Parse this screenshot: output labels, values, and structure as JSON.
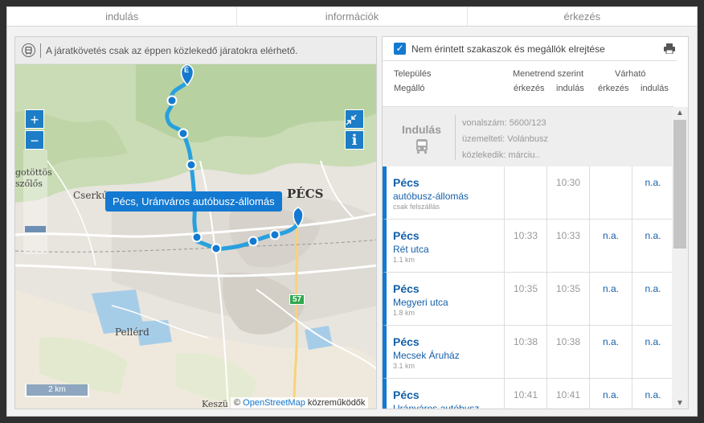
{
  "tabs": [
    "indulás",
    "információk",
    "érkezés"
  ],
  "map": {
    "notice": "A járatkövetés csak az éppen közlekedő járatokra elérhető.",
    "zoom_in": "+",
    "zoom_out": "−",
    "info_button": "i",
    "popup": "Pécs, Uránváros autóbusz-állomás",
    "scale": "2 km",
    "attribution_prefix": "©",
    "attribution_link": "OpenStreetMap",
    "attribution_suffix": "közreműködők",
    "labels": {
      "pecs": "PÉCS",
      "cserkut": "Cserkút",
      "pellerd": "Pellérd",
      "keszu": "Keszü",
      "kotottos": "gotöttös",
      "szolos": "szőlős",
      "road": "57",
      "start_marker": "É"
    },
    "colors": {
      "route": "#28a0de",
      "accent": "#1479d0",
      "road_badge": "#2fa84f"
    }
  },
  "timetable": {
    "filter_label": "Nem érintett szakaszok és megállók elrejtése",
    "filter_checked": true,
    "headers": {
      "telepules": "Település",
      "megallo": "Megálló",
      "menetrend": "Menetrend szerint",
      "varhato": "Várható",
      "erkezes": "érkezés",
      "indulas": "indulás"
    },
    "start": {
      "title": "Indulás",
      "line": "vonalszám: 5600/123",
      "operator": "üzemelteti: Volánbusz",
      "runs": "közlekedik: márciu.."
    },
    "stops": [
      {
        "town": "Pécs",
        "name": "autóbusz-állomás",
        "dist": "csak felszállás",
        "sched_arr": "",
        "sched_dep": "10:30",
        "exp_arr": "",
        "exp_dep": "n.a."
      },
      {
        "town": "Pécs",
        "name": "Rét utca",
        "dist": "1.1 km",
        "sched_arr": "10:33",
        "sched_dep": "10:33",
        "exp_arr": "n.a.",
        "exp_dep": "n.a."
      },
      {
        "town": "Pécs",
        "name": "Megyeri utca",
        "dist": "1.8 km",
        "sched_arr": "10:35",
        "sched_dep": "10:35",
        "exp_arr": "n.a.",
        "exp_dep": "n.a."
      },
      {
        "town": "Pécs",
        "name": "Mecsek Áruház",
        "dist": "3.1 km",
        "sched_arr": "10:38",
        "sched_dep": "10:38",
        "exp_arr": "n.a.",
        "exp_dep": "n.a."
      },
      {
        "town": "Pécs",
        "name": "Uránváros autóbusz-",
        "dist": "",
        "sched_arr": "10:41",
        "sched_dep": "10:41",
        "exp_arr": "n.a.",
        "exp_dep": "n.a."
      }
    ]
  }
}
